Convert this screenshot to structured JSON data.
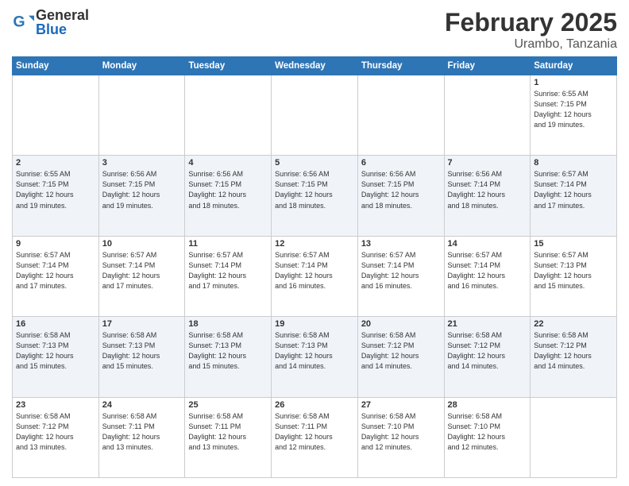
{
  "header": {
    "logo_general": "General",
    "logo_blue": "Blue",
    "month_title": "February 2025",
    "location": "Urambo, Tanzania"
  },
  "days_of_week": [
    "Sunday",
    "Monday",
    "Tuesday",
    "Wednesday",
    "Thursday",
    "Friday",
    "Saturday"
  ],
  "weeks": [
    [
      {
        "day": "",
        "info": ""
      },
      {
        "day": "",
        "info": ""
      },
      {
        "day": "",
        "info": ""
      },
      {
        "day": "",
        "info": ""
      },
      {
        "day": "",
        "info": ""
      },
      {
        "day": "",
        "info": ""
      },
      {
        "day": "1",
        "info": "Sunrise: 6:55 AM\nSunset: 7:15 PM\nDaylight: 12 hours\nand 19 minutes."
      }
    ],
    [
      {
        "day": "2",
        "info": "Sunrise: 6:55 AM\nSunset: 7:15 PM\nDaylight: 12 hours\nand 19 minutes."
      },
      {
        "day": "3",
        "info": "Sunrise: 6:56 AM\nSunset: 7:15 PM\nDaylight: 12 hours\nand 19 minutes."
      },
      {
        "day": "4",
        "info": "Sunrise: 6:56 AM\nSunset: 7:15 PM\nDaylight: 12 hours\nand 18 minutes."
      },
      {
        "day": "5",
        "info": "Sunrise: 6:56 AM\nSunset: 7:15 PM\nDaylight: 12 hours\nand 18 minutes."
      },
      {
        "day": "6",
        "info": "Sunrise: 6:56 AM\nSunset: 7:15 PM\nDaylight: 12 hours\nand 18 minutes."
      },
      {
        "day": "7",
        "info": "Sunrise: 6:56 AM\nSunset: 7:14 PM\nDaylight: 12 hours\nand 18 minutes."
      },
      {
        "day": "8",
        "info": "Sunrise: 6:57 AM\nSunset: 7:14 PM\nDaylight: 12 hours\nand 17 minutes."
      }
    ],
    [
      {
        "day": "9",
        "info": "Sunrise: 6:57 AM\nSunset: 7:14 PM\nDaylight: 12 hours\nand 17 minutes."
      },
      {
        "day": "10",
        "info": "Sunrise: 6:57 AM\nSunset: 7:14 PM\nDaylight: 12 hours\nand 17 minutes."
      },
      {
        "day": "11",
        "info": "Sunrise: 6:57 AM\nSunset: 7:14 PM\nDaylight: 12 hours\nand 17 minutes."
      },
      {
        "day": "12",
        "info": "Sunrise: 6:57 AM\nSunset: 7:14 PM\nDaylight: 12 hours\nand 16 minutes."
      },
      {
        "day": "13",
        "info": "Sunrise: 6:57 AM\nSunset: 7:14 PM\nDaylight: 12 hours\nand 16 minutes."
      },
      {
        "day": "14",
        "info": "Sunrise: 6:57 AM\nSunset: 7:14 PM\nDaylight: 12 hours\nand 16 minutes."
      },
      {
        "day": "15",
        "info": "Sunrise: 6:57 AM\nSunset: 7:13 PM\nDaylight: 12 hours\nand 15 minutes."
      }
    ],
    [
      {
        "day": "16",
        "info": "Sunrise: 6:58 AM\nSunset: 7:13 PM\nDaylight: 12 hours\nand 15 minutes."
      },
      {
        "day": "17",
        "info": "Sunrise: 6:58 AM\nSunset: 7:13 PM\nDaylight: 12 hours\nand 15 minutes."
      },
      {
        "day": "18",
        "info": "Sunrise: 6:58 AM\nSunset: 7:13 PM\nDaylight: 12 hours\nand 15 minutes."
      },
      {
        "day": "19",
        "info": "Sunrise: 6:58 AM\nSunset: 7:13 PM\nDaylight: 12 hours\nand 14 minutes."
      },
      {
        "day": "20",
        "info": "Sunrise: 6:58 AM\nSunset: 7:12 PM\nDaylight: 12 hours\nand 14 minutes."
      },
      {
        "day": "21",
        "info": "Sunrise: 6:58 AM\nSunset: 7:12 PM\nDaylight: 12 hours\nand 14 minutes."
      },
      {
        "day": "22",
        "info": "Sunrise: 6:58 AM\nSunset: 7:12 PM\nDaylight: 12 hours\nand 14 minutes."
      }
    ],
    [
      {
        "day": "23",
        "info": "Sunrise: 6:58 AM\nSunset: 7:12 PM\nDaylight: 12 hours\nand 13 minutes."
      },
      {
        "day": "24",
        "info": "Sunrise: 6:58 AM\nSunset: 7:11 PM\nDaylight: 12 hours\nand 13 minutes."
      },
      {
        "day": "25",
        "info": "Sunrise: 6:58 AM\nSunset: 7:11 PM\nDaylight: 12 hours\nand 13 minutes."
      },
      {
        "day": "26",
        "info": "Sunrise: 6:58 AM\nSunset: 7:11 PM\nDaylight: 12 hours\nand 12 minutes."
      },
      {
        "day": "27",
        "info": "Sunrise: 6:58 AM\nSunset: 7:10 PM\nDaylight: 12 hours\nand 12 minutes."
      },
      {
        "day": "28",
        "info": "Sunrise: 6:58 AM\nSunset: 7:10 PM\nDaylight: 12 hours\nand 12 minutes."
      },
      {
        "day": "",
        "info": ""
      }
    ]
  ]
}
